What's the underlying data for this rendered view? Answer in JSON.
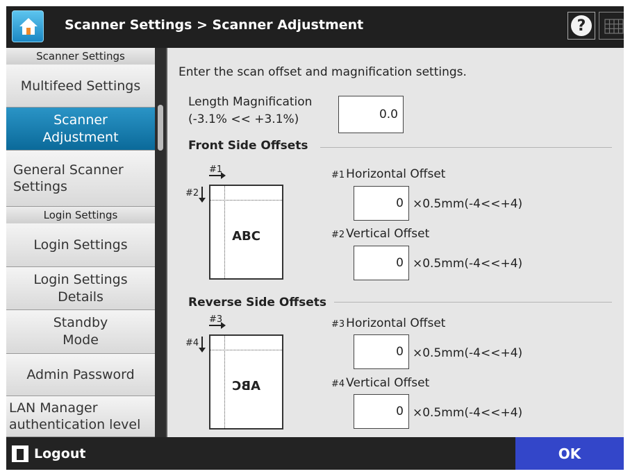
{
  "header": {
    "title": "Scanner Settings > Scanner Adjustment",
    "home_icon": "home-icon",
    "help_label": "?",
    "keyboard_icon": "keyboard-icon"
  },
  "sidebar": {
    "group1": "Scanner Settings",
    "items1": [
      "Multifeed Settings",
      "Scanner Adjustment",
      "General Scanner Settings"
    ],
    "active_item": "Scanner Adjustment",
    "group2": "Login Settings",
    "items2": [
      "Login Settings",
      "Login Settings Details",
      "Standby Mode",
      "Admin Password",
      "LAN Manager authentication level"
    ]
  },
  "content": {
    "intro": "Enter the scan offset and magnification settings.",
    "length_mag": {
      "label": "Length Magnification",
      "range": "(-3.1% << +3.1%)",
      "value": "0.0"
    },
    "front": {
      "title": "Front Side Offsets",
      "h_mark": "#1",
      "v_mark": "#2",
      "diagram_text": "ABC",
      "h_label_mark": "#1",
      "h_label": "Horizontal Offset",
      "h_value": "0",
      "v_label_mark": "#2",
      "v_label": "Vertical Offset",
      "v_value": "0"
    },
    "reverse": {
      "title": "Reverse Side Offsets",
      "h_mark": "#3",
      "v_mark": "#4",
      "diagram_text": "ABC",
      "h_label_mark": "#3",
      "h_label": "Horizontal Offset",
      "h_value": "0",
      "v_label_mark": "#4",
      "v_label": "Vertical Offset",
      "v_value": "0"
    },
    "unit": "×0.5mm(-4<<+4)"
  },
  "footer": {
    "logout": "Logout",
    "ok": "OK"
  },
  "colors": {
    "active_item": "#0b6a9a",
    "ok_button": "#3346c9",
    "home_button": "#1c88c4"
  }
}
